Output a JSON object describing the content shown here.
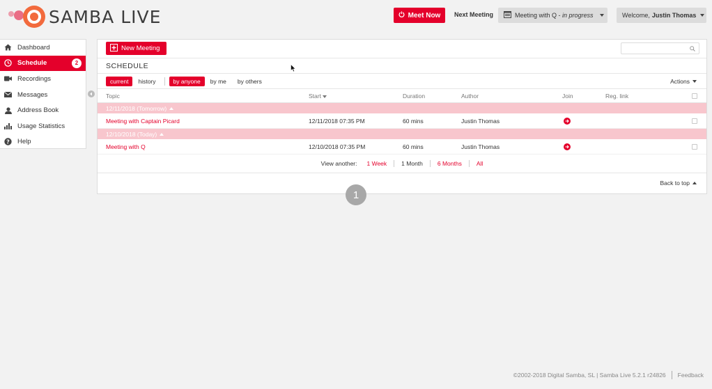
{
  "app": {
    "logo_text": "SAMBA LIVE",
    "accent": "#e4002b"
  },
  "header": {
    "meet_now": "Meet Now",
    "next_meeting_label": "Next Meeting",
    "next_meeting_title": "Meeting with Q - ",
    "next_meeting_status": "in progress",
    "welcome_prefix": "Welcome, ",
    "user_name": "Justin Thomas"
  },
  "sidebar": {
    "items": [
      {
        "label": "Dashboard",
        "icon": "home-icon"
      },
      {
        "label": "Schedule",
        "icon": "clock-icon",
        "badge": "2",
        "active": true
      },
      {
        "label": "Recordings",
        "icon": "video-camera-icon"
      },
      {
        "label": "Messages",
        "icon": "envelope-icon"
      },
      {
        "label": "Address Book",
        "icon": "person-icon"
      },
      {
        "label": "Usage Statistics",
        "icon": "bar-chart-icon"
      },
      {
        "label": "Help",
        "icon": "question-icon"
      }
    ]
  },
  "panel": {
    "new_meeting": "New Meeting",
    "search_placeholder": "",
    "title": "SCHEDULE",
    "filters": {
      "current": "current",
      "history": "history",
      "by_anyone": "by anyone",
      "by_me": "by me",
      "by_others": "by others"
    },
    "actions": "Actions",
    "columns": {
      "topic": "Topic",
      "start": "Start",
      "duration": "Duration",
      "author": "Author",
      "join": "Join",
      "reg_link": "Reg. link"
    },
    "groups": [
      {
        "label": "12/11/2018 (Tomorrow)",
        "row": {
          "topic": "Meeting with Captain Picard",
          "start": "12/11/2018 07:35 PM",
          "duration": "60 mins",
          "author": "Justin Thomas"
        }
      },
      {
        "label": "12/10/2018 (Today)",
        "row": {
          "topic": "Meeting with Q",
          "start": "12/10/2018 07:35 PM",
          "duration": "60 mins",
          "author": "Justin Thomas"
        }
      }
    ],
    "view_another": {
      "label": "View another:",
      "week": "1 Week",
      "month": "1 Month",
      "six_months": "6 Months",
      "all": "All"
    },
    "back_to_top": "Back to top"
  },
  "step_marker": "1",
  "footer": {
    "copyright": "©2002-2018 Digital Samba, SL | Samba Live 5.2.1 r24826",
    "feedback": "Feedback"
  }
}
